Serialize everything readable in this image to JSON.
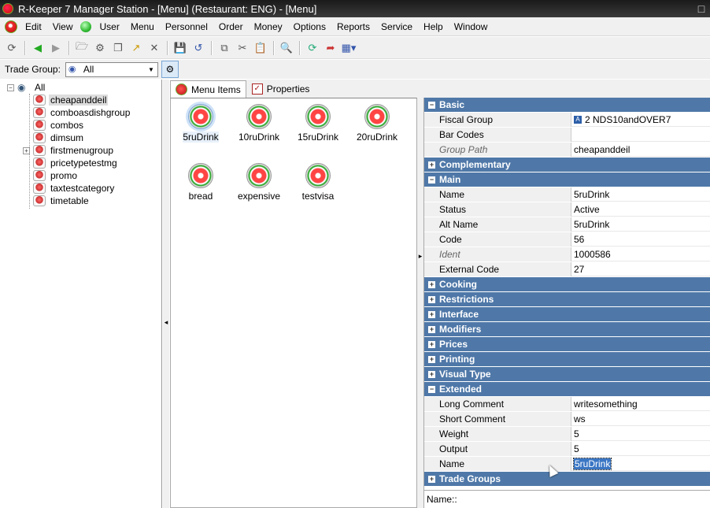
{
  "window": {
    "title": "R-Keeper 7 Manager Station - [Menu] (Restaurant: ENG) - [Menu]",
    "max_icon": "maximize-icon"
  },
  "menubar": {
    "items": [
      "Edit",
      "View",
      "User",
      "Menu",
      "Personnel",
      "Order",
      "Money",
      "Options",
      "Reports",
      "Service",
      "Help",
      "Window"
    ]
  },
  "toolbar": {
    "icons": [
      "refresh-icon",
      "back-icon",
      "forward-icon",
      "new-folder-icon",
      "properties-icon",
      "copy-item-icon",
      "export-icon",
      "delete-icon",
      "save-icon",
      "undo-icon",
      "copy-icon",
      "cut-icon",
      "paste-icon",
      "search-icon",
      "reload-icon",
      "move-icon",
      "view-mode-icon"
    ]
  },
  "trade_group": {
    "label": "Trade Group:",
    "value": "All"
  },
  "tree": {
    "root": "All",
    "items": [
      {
        "label": "cheapanddeil",
        "selected": true,
        "expandable": false
      },
      {
        "label": "comboasdishgroup",
        "selected": false,
        "expandable": false
      },
      {
        "label": "combos",
        "selected": false,
        "expandable": false
      },
      {
        "label": "dimsum",
        "selected": false,
        "expandable": false
      },
      {
        "label": "firstmenugroup",
        "selected": false,
        "expandable": true
      },
      {
        "label": "pricetypetestmg",
        "selected": false,
        "expandable": false
      },
      {
        "label": "promo",
        "selected": false,
        "expandable": false
      },
      {
        "label": "taxtestcategory",
        "selected": false,
        "expandable": false
      },
      {
        "label": "timetable",
        "selected": false,
        "expandable": false
      }
    ]
  },
  "tabs": {
    "menu_items": "Menu Items",
    "properties": "Properties"
  },
  "menu_items": [
    "5ruDrink",
    "10ruDrink",
    "15ruDrink",
    "20ruDrink",
    "bread",
    "expensive",
    "testvisa"
  ],
  "properties": {
    "rows": [
      {
        "kind": "cat",
        "label": "Basic",
        "open": true
      },
      {
        "kind": "prop",
        "name": "Fiscal Group",
        "value": "2 NDS10andOVER7",
        "icon": true
      },
      {
        "kind": "prop",
        "name": "Bar Codes",
        "value": ""
      },
      {
        "kind": "prop",
        "name": "Group Path",
        "value": "cheapanddeil",
        "readonly": true
      },
      {
        "kind": "cat",
        "label": "Complementary",
        "open": false
      },
      {
        "kind": "cat",
        "label": "Main",
        "open": true
      },
      {
        "kind": "prop",
        "name": "Name",
        "value": "5ruDrink"
      },
      {
        "kind": "prop",
        "name": "Status",
        "value": "Active"
      },
      {
        "kind": "prop",
        "name": "Alt Name",
        "value": "5ruDrink"
      },
      {
        "kind": "prop",
        "name": "Code",
        "value": "56"
      },
      {
        "kind": "prop",
        "name": "Ident",
        "value": "1000586",
        "readonly": true
      },
      {
        "kind": "prop",
        "name": "External Code",
        "value": "27"
      },
      {
        "kind": "cat",
        "label": "Cooking",
        "open": false
      },
      {
        "kind": "cat",
        "label": "Restrictions",
        "open": false
      },
      {
        "kind": "cat",
        "label": "Interface",
        "open": false
      },
      {
        "kind": "cat",
        "label": "Modifiers",
        "open": false
      },
      {
        "kind": "cat",
        "label": "Prices",
        "open": false
      },
      {
        "kind": "cat",
        "label": "Printing",
        "open": false
      },
      {
        "kind": "cat",
        "label": "Visual Type",
        "open": false
      },
      {
        "kind": "cat",
        "label": "Extended",
        "open": true
      },
      {
        "kind": "prop",
        "name": "Long Comment",
        "value": "writesomething"
      },
      {
        "kind": "prop",
        "name": "Short Comment",
        "value": "ws"
      },
      {
        "kind": "prop",
        "name": "Weight",
        "value": "5"
      },
      {
        "kind": "prop",
        "name": "Output",
        "value": "5"
      },
      {
        "kind": "prop",
        "name": "Name",
        "value": "5ruDrink",
        "editing": true
      },
      {
        "kind": "cat",
        "label": "Trade Groups",
        "open": false
      }
    ]
  },
  "name_hint": "Name::",
  "colors": {
    "category_bar": "#4f78a8",
    "panel": "#f0f0f0",
    "selection": "#3a76c4"
  }
}
